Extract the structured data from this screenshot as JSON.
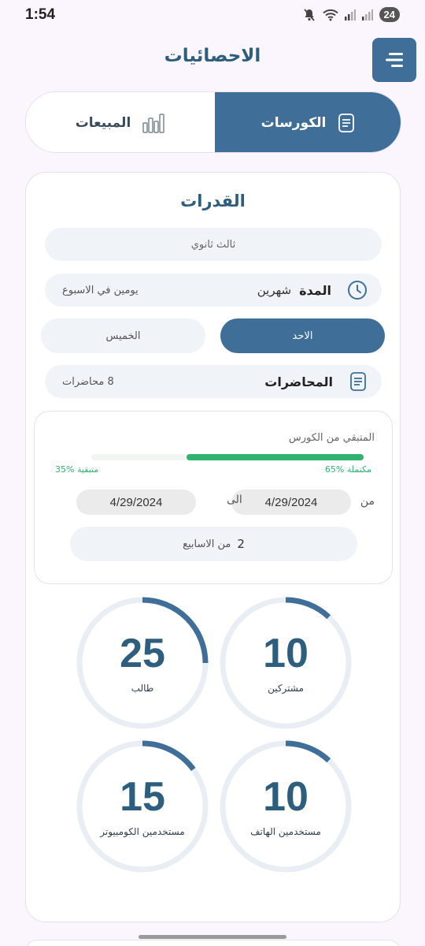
{
  "status": {
    "time": "1:54",
    "battery": "24"
  },
  "header": {
    "title": "الاحصائيات"
  },
  "tabs": {
    "courses": "الكورسات",
    "sales": "المبيعات"
  },
  "course": {
    "title": "القدرات",
    "grade": "ثالث ثانوي",
    "duration_label": "المدة",
    "duration_value": "شهرين",
    "schedule": "يومين في الاسبوع",
    "days": [
      "الاحد",
      "الخميس"
    ],
    "lectures_label": "المحاضرات",
    "lectures_count": "8 محاضرات"
  },
  "progress": {
    "title": "المتبقي من الكورس",
    "completed_percent": 65,
    "completed_text": "65% مكتملة",
    "remaining_text": "35% متبقية",
    "from_label": "من",
    "to_label": "الى",
    "from_date": "4/29/2024",
    "to_date": "4/29/2024",
    "weeks_count": "2",
    "weeks_label": "من الاسابيع"
  },
  "stats": [
    {
      "value": "10",
      "label": "مشتركين",
      "fraction": 0.12
    },
    {
      "value": "25",
      "label": "طالب",
      "fraction": 0.25
    },
    {
      "value": "10",
      "label": "مستخدمين الهاتف",
      "fraction": 0.12
    },
    {
      "value": "15",
      "label": "مستخدمين الكومبيوتر",
      "fraction": 0.15
    }
  ],
  "colors": {
    "primary": "#3f6f98",
    "title": "#2e5e7e",
    "success": "#2fb36f",
    "ring_track": "#e8eef4"
  }
}
